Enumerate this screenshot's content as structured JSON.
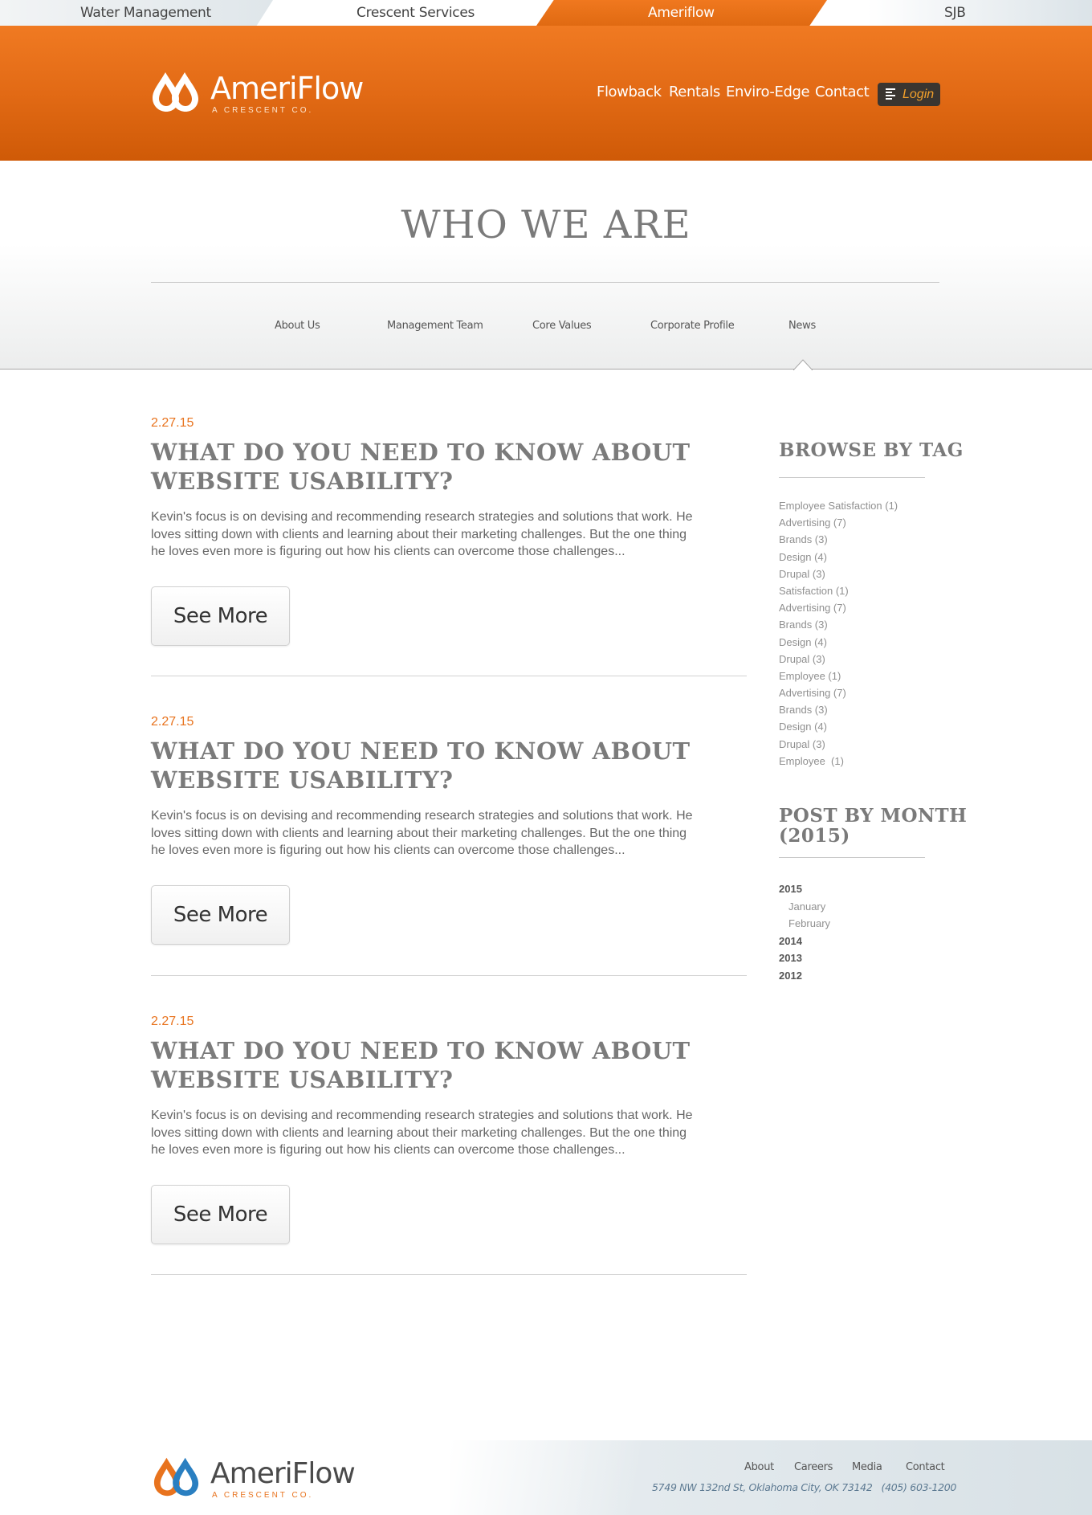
{
  "topbar": {
    "links": [
      "Water Management",
      "Crescent Services",
      "Ameriflow",
      "SJB"
    ],
    "active_index": 2
  },
  "header": {
    "logo_word": "AmeriFlow",
    "logo_tag": "A CRESCENT CO.",
    "nav": [
      "Flowback",
      "Rentals",
      "Enviro-Edge",
      "Contact"
    ],
    "login_label": "Login",
    "brand_color": "#e8731e"
  },
  "section": {
    "title": "WHO WE ARE",
    "subnav": [
      "About Us",
      "Management Team",
      "Core Values",
      "Corporate Profile",
      "News"
    ],
    "active_subnav": "News"
  },
  "posts": [
    {
      "date": "2.27.15",
      "title_line1": "WHAT DO YOU NEED TO KNOW ABOUT",
      "title_line2": "WEBSITE USABILITY?",
      "excerpt_line1": "Kevin's focus is on devising and recommending research strategies and solutions that work. He",
      "excerpt_line2": "loves sitting down with clients and learning about their marketing challenges. But the one thing",
      "excerpt_line3": "he loves even more is figuring out how his clients can overcome those challenges...",
      "button": "See More"
    },
    {
      "date": "2.27.15",
      "title_line1": "WHAT DO YOU NEED TO KNOW ABOUT",
      "title_line2": "WEBSITE USABILITY?",
      "excerpt_line1": "Kevin's focus is on devising and recommending research strategies and solutions that work. He",
      "excerpt_line2": "loves sitting down with clients and learning about their marketing challenges. But the one thing",
      "excerpt_line3": "he loves even more is figuring out how his clients can overcome those challenges...",
      "button": "See More"
    },
    {
      "date": "2.27.15",
      "title_line1": "WHAT DO YOU NEED TO KNOW ABOUT",
      "title_line2": "WEBSITE USABILITY?",
      "excerpt_line1": "Kevin's focus is on devising and recommending research strategies and solutions that work. He",
      "excerpt_line2": "loves sitting down with clients and learning about their marketing challenges. But the one thing",
      "excerpt_line3": "he loves even more is figuring out how his clients can overcome those challenges...",
      "button": "See More"
    }
  ],
  "sidebar": {
    "tags_title": "BROWSE BY TAG",
    "tags": [
      "Employee Satisfaction (1)",
      "Advertising (7)",
      "Brands (3)",
      "Design (4)",
      "Drupal (3)",
      "Satisfaction (1)",
      "Advertising (7)",
      "Brands (3)",
      "Design (4)",
      "Drupal (3)",
      "Employee (1)",
      "Advertising (7)",
      "Brands (3)",
      "Design (4)",
      "Drupal (3)",
      "Employee  (1)"
    ],
    "months_title_line1": "POST BY MONTH",
    "months_title_line2": "(2015)",
    "archive": [
      {
        "label": "2015",
        "kind": "year"
      },
      {
        "label": "January",
        "kind": "month"
      },
      {
        "label": "February",
        "kind": "month"
      },
      {
        "label": "2014",
        "kind": "year"
      },
      {
        "label": "2013",
        "kind": "year"
      },
      {
        "label": "2012",
        "kind": "year"
      }
    ]
  },
  "footer": {
    "logo_word": "AmeriFlow",
    "logo_tag": "A CRESCENT CO.",
    "links": [
      "About",
      "Careers",
      "Media",
      "Contact"
    ],
    "address": "5749 NW 132nd St, Oklahoma City, OK 73142",
    "phone": "(405) 603-1200"
  }
}
